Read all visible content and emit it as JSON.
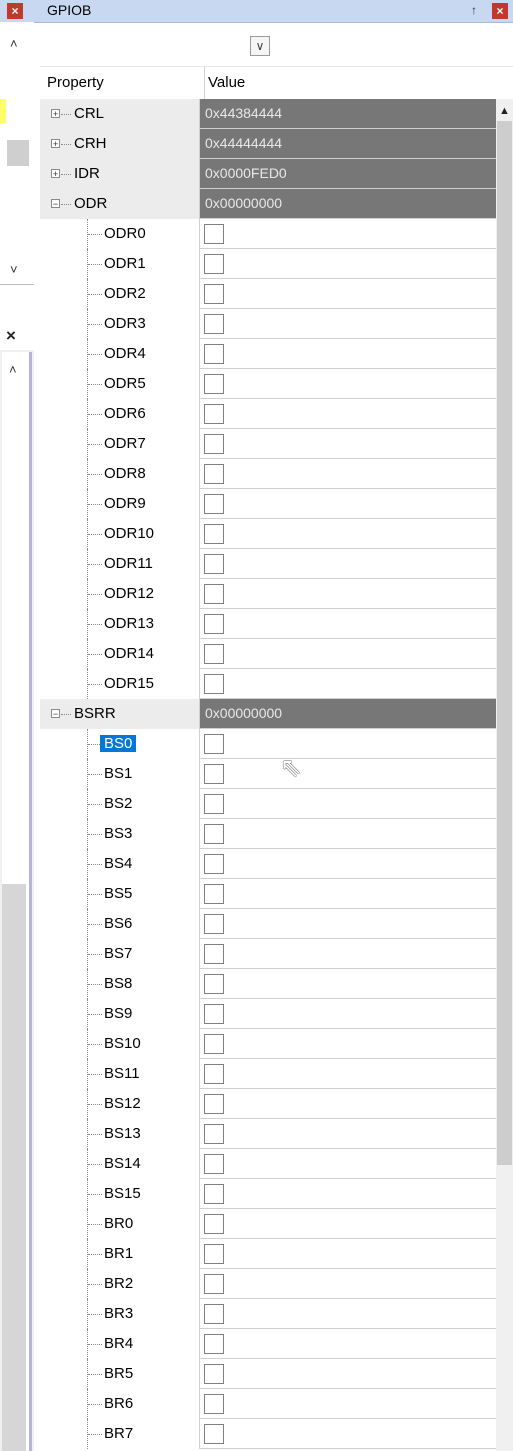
{
  "window": {
    "title": "GPIOB",
    "pin_glyph": "↑",
    "close_glyph": "×",
    "dropdown_glyph": "∨"
  },
  "left_panel": {
    "close_glyph": "×",
    "close2_glyph": "×",
    "up_glyph": "˄",
    "down_glyph": "˅",
    "up2_glyph": "˄"
  },
  "header": {
    "property": "Property",
    "value": "Value"
  },
  "groups": {
    "crl": {
      "label": "CRL",
      "value": "0x44384444",
      "expander": "+"
    },
    "crh": {
      "label": "CRH",
      "value": "0x44444444",
      "expander": "+"
    },
    "idr": {
      "label": "IDR",
      "value": "0x0000FED0",
      "expander": "+"
    },
    "odr": {
      "label": "ODR",
      "value": "0x00000000",
      "expander": "−"
    },
    "bsrr": {
      "label": "BSRR",
      "value": "0x00000000",
      "expander": "−"
    }
  },
  "odr_bits": [
    "ODR0",
    "ODR1",
    "ODR2",
    "ODR3",
    "ODR4",
    "ODR5",
    "ODR6",
    "ODR7",
    "ODR8",
    "ODR9",
    "ODR10",
    "ODR11",
    "ODR12",
    "ODR13",
    "ODR14",
    "ODR15"
  ],
  "bsrr_bits": [
    "BS0",
    "BS1",
    "BS2",
    "BS3",
    "BS4",
    "BS5",
    "BS6",
    "BS7",
    "BS8",
    "BS9",
    "BS10",
    "BS11",
    "BS12",
    "BS13",
    "BS14",
    "BS15",
    "BR0",
    "BR1",
    "BR2",
    "BR3",
    "BR4",
    "BR5",
    "BR6",
    "BR7"
  ],
  "selected_bit": "BS0",
  "scrollbar": {
    "up_glyph": "▲"
  },
  "cursor_glyph": "⇖"
}
